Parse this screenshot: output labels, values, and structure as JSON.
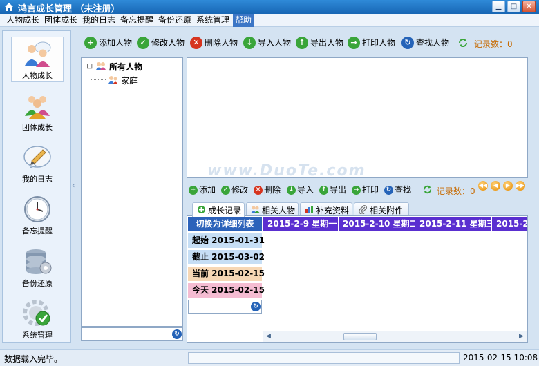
{
  "window": {
    "title": "鸿言成长管理 （未注册）",
    "minimize_glyph": "▁",
    "maximize_glyph": "□",
    "close_glyph": "✕"
  },
  "menu": [
    "人物成长",
    "团体成长",
    "我的日志",
    "备忘提醒",
    "备份还原",
    "系统管理",
    "帮助"
  ],
  "nav": [
    {
      "label": "人物成长",
      "icon": "people-icon"
    },
    {
      "label": "团体成长",
      "icon": "group-icon"
    },
    {
      "label": "我的日志",
      "icon": "diary-icon"
    },
    {
      "label": "备忘提醒",
      "icon": "clock-icon"
    },
    {
      "label": "备份还原",
      "icon": "database-icon"
    },
    {
      "label": "系统管理",
      "icon": "gear-check-icon"
    }
  ],
  "toolbar": {
    "buttons": [
      {
        "label": "添加人物",
        "glyph": "+",
        "color": "#3aa53a"
      },
      {
        "label": "修改人物",
        "glyph": "✓",
        "color": "#3aa53a"
      },
      {
        "label": "删除人物",
        "glyph": "✕",
        "color": "#d6341f"
      },
      {
        "label": "导入人物",
        "glyph": "↓",
        "color": "#3aa53a"
      },
      {
        "label": "导出人物",
        "glyph": "↑",
        "color": "#3aa53a"
      },
      {
        "label": "打印人物",
        "glyph": "→",
        "color": "#3aa53a"
      },
      {
        "label": "查找人物",
        "glyph": "↻",
        "color": "#2563b8"
      }
    ],
    "record_count": "记录数：0"
  },
  "tree": {
    "root": "所有人物",
    "child": "家庭",
    "expander": "⊟"
  },
  "watermark": "www.DuoTe.com",
  "subtoolbar": {
    "buttons": [
      {
        "label": "添加",
        "glyph": "+",
        "color": "#3aa53a"
      },
      {
        "label": "修改",
        "glyph": "✓",
        "color": "#3aa53a"
      },
      {
        "label": "删除",
        "glyph": "✕",
        "color": "#d6341f"
      },
      {
        "label": "导入",
        "glyph": "↓",
        "color": "#3aa53a"
      },
      {
        "label": "导出",
        "glyph": "↑",
        "color": "#3aa53a"
      },
      {
        "label": "打印",
        "glyph": "→",
        "color": "#3aa53a"
      },
      {
        "label": "查找",
        "glyph": "↻",
        "color": "#2563b8"
      }
    ],
    "record_count": "记录数：0",
    "nav_glyphs": [
      "◀◀",
      "◀",
      "▶",
      "▶▶"
    ]
  },
  "tabs": [
    {
      "label": "成长记录",
      "icon": "growth-record-icon",
      "active": true
    },
    {
      "label": "相关人物",
      "icon": "people-icon",
      "active": false
    },
    {
      "label": "补充资料",
      "icon": "chart-icon",
      "active": false
    },
    {
      "label": "相关附件",
      "icon": "paperclip-icon",
      "active": false
    }
  ],
  "calendar": {
    "switch_label": "切换为详细列表",
    "start": "起始  2015-01-31",
    "end": "截止  2015-03-02",
    "current": "当前  2015-02-15",
    "today": "今天  2015-02-15",
    "days": [
      "2015-2-9  星期一",
      "2015-2-10  星期二",
      "2015-2-11  星期三",
      "2015-2-"
    ],
    "colors": {
      "start": "#c6def5",
      "end": "#c6def5",
      "current": "#f6d7b5",
      "today": "#f5bcd2"
    }
  },
  "scroll": {
    "left_arrow": "◀",
    "right_arrow": "▶"
  },
  "status": {
    "message": "数据载入完毕。",
    "datetime": "2015-02-15  10:08"
  }
}
